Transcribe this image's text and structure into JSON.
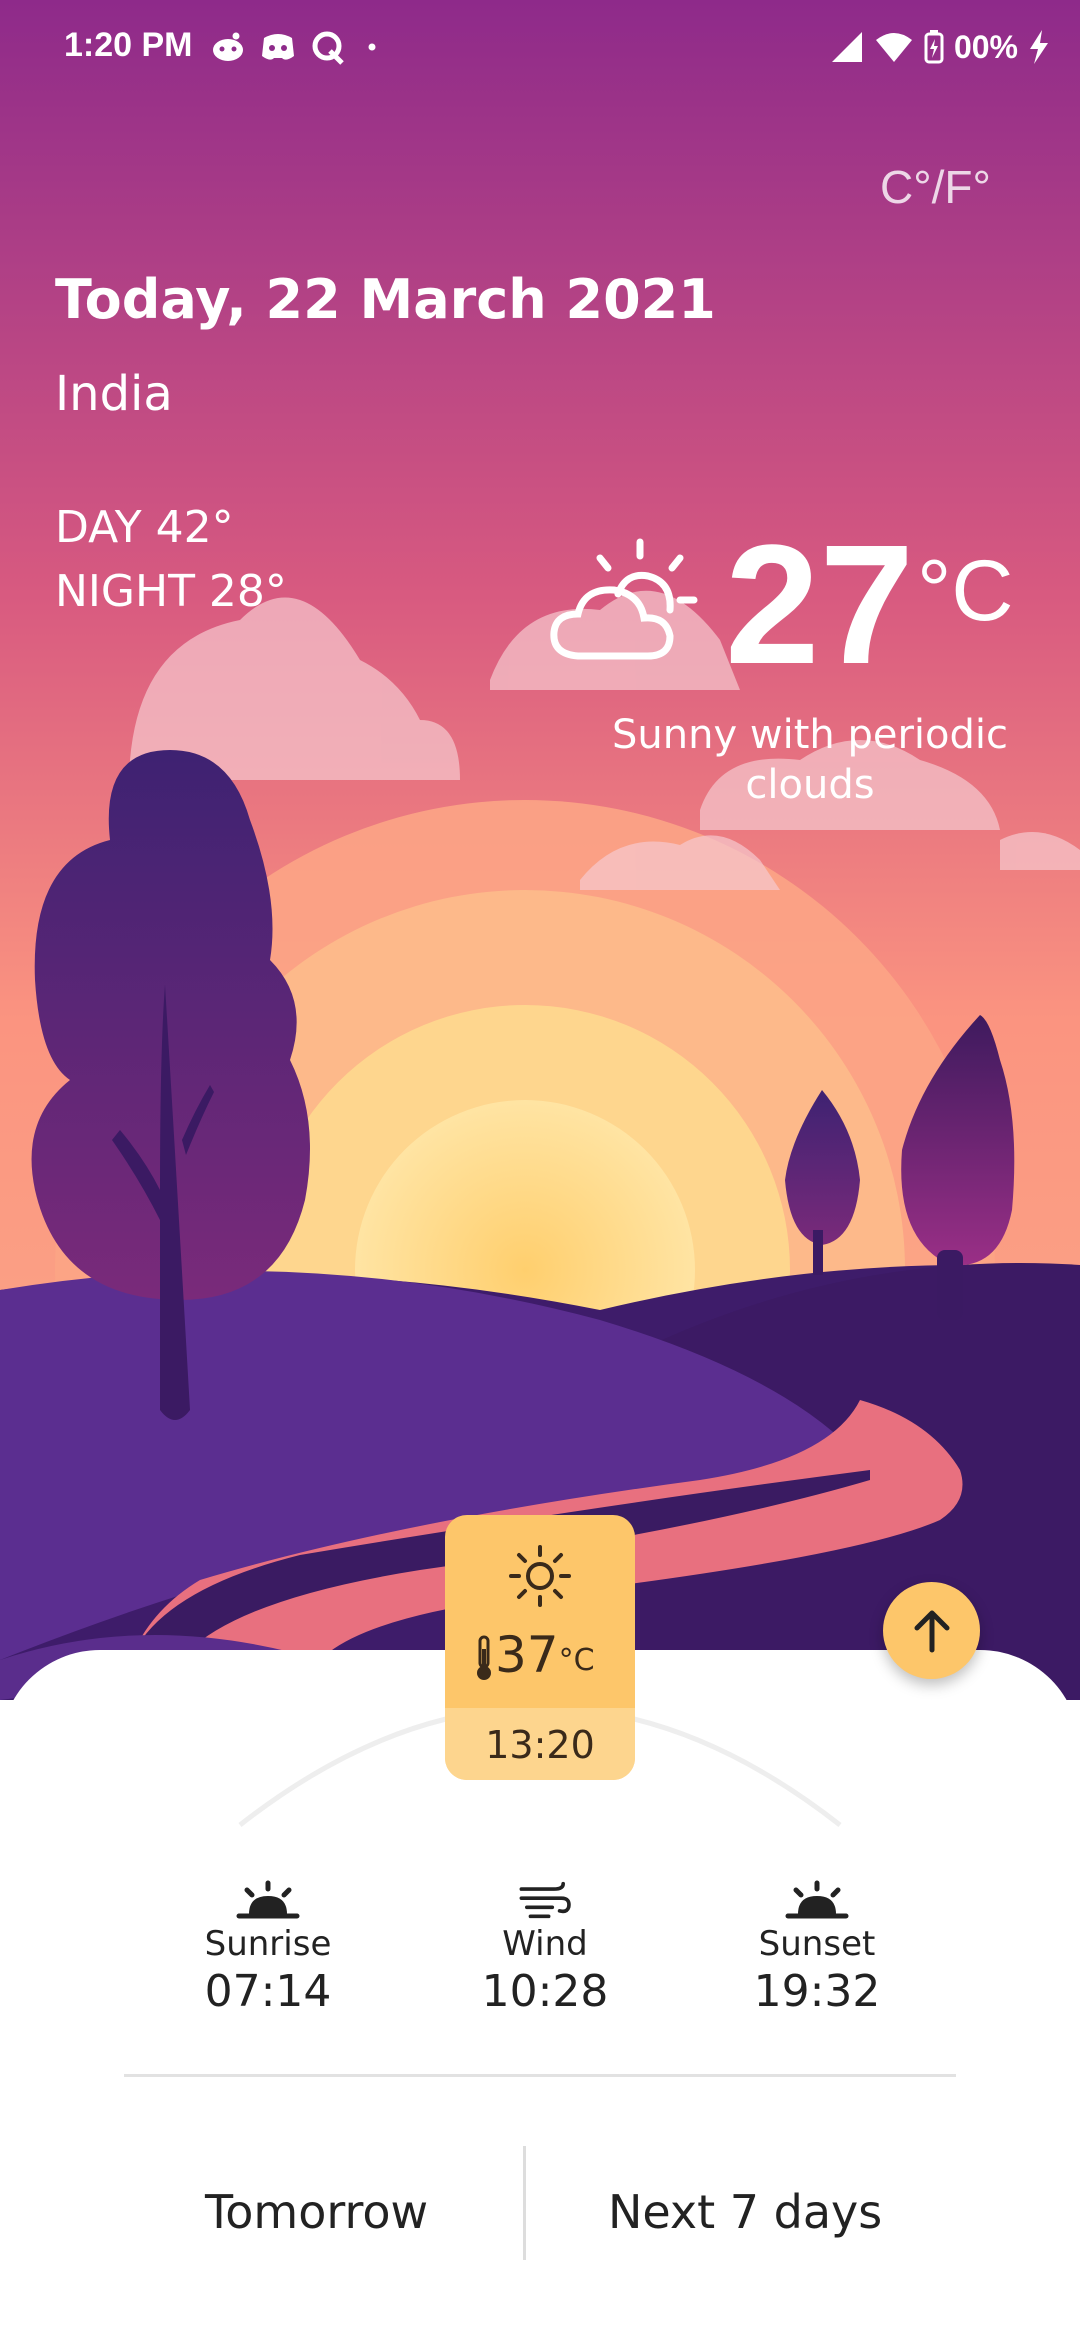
{
  "status_bar": {
    "time": "1:20 PM",
    "battery": "00%",
    "icons": [
      "reddit-icon",
      "discord-icon",
      "quora-icon",
      "dot-icon",
      "signal-icon",
      "wifi-icon",
      "battery-icon",
      "charging-icon"
    ]
  },
  "header": {
    "unit_toggle": "C°/F°",
    "date": "Today, 22 March 2021",
    "location": "India",
    "day": "DAY 42°",
    "night": "NIGHT 28°"
  },
  "current": {
    "temp": "27",
    "unit": "°C",
    "condition": "Sunny with periodic clouds",
    "icon": "partly-cloudy-icon"
  },
  "now_card": {
    "icon": "sun-icon",
    "temp": "37",
    "unit": "°C",
    "time": "13:20"
  },
  "stats": {
    "sunrise": {
      "label": "Sunrise",
      "value": "07:14"
    },
    "wind": {
      "label": "Wind",
      "value": "10:28"
    },
    "sunset": {
      "label": "Sunset",
      "value": "19:32"
    }
  },
  "tabs": {
    "tomorrow": "Tomorrow",
    "next7": "Next 7 days"
  },
  "colors": {
    "sky_top": "#8e2a8a",
    "sky_mid": "#e46a82",
    "sky_bottom": "#fbb08a",
    "sun": "#ffd27e",
    "hill": "#5a2d8c",
    "accent": "#fdc66a"
  }
}
